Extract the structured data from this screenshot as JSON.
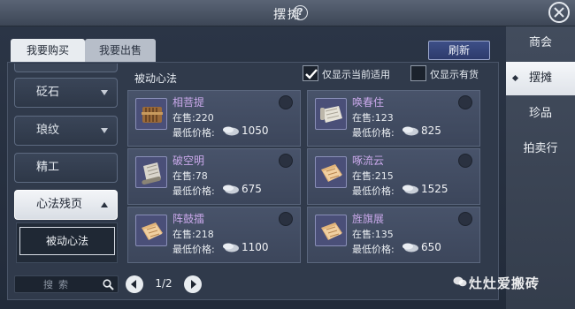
{
  "header": {
    "title": "摆摊",
    "help_symbol": "?"
  },
  "tabs": [
    {
      "label": "我要购买",
      "active": true
    },
    {
      "label": "我要出售",
      "active": false
    }
  ],
  "refresh_label": "刷新",
  "sidebar": {
    "items": [
      {
        "label": "砭石",
        "expandable": true
      },
      {
        "label": "琅纹",
        "expandable": true
      },
      {
        "label": "精工",
        "expandable": false
      },
      {
        "label": "心法残页",
        "expandable": true,
        "expanded": true
      }
    ],
    "sub_items": [
      {
        "label": "被动心法",
        "selected": true
      }
    ]
  },
  "search": {
    "placeholder": "搜索"
  },
  "pagination": {
    "text": "1/2"
  },
  "category_title": "被动心法",
  "filters": [
    {
      "label": "仅显示当前适用",
      "checked": true
    },
    {
      "label": "仅显示有货",
      "checked": false
    }
  ],
  "items": [
    {
      "name": "相菩提",
      "stock": "在售:220",
      "price_label": "最低价格:",
      "price": "1050",
      "icon": "bamboo-scroll-icon"
    },
    {
      "name": "唤春住",
      "stock": "在售:123",
      "price_label": "最低价格:",
      "price": "825",
      "icon": "paper-scroll-icon"
    },
    {
      "name": "破空明",
      "stock": "在售:78",
      "price_label": "最低价格:",
      "price": "675",
      "icon": "rolled-scroll-icon"
    },
    {
      "name": "啄流云",
      "stock": "在售:215",
      "price_label": "最低价格:",
      "price": "1525",
      "icon": "paper-pages-icon"
    },
    {
      "name": "阵鼓擂",
      "stock": "在售:218",
      "price_label": "最低价格:",
      "price": "1100",
      "icon": "paper-pages-icon"
    },
    {
      "name": "旌旗展",
      "stock": "在售:135",
      "price_label": "最低价格:",
      "price": "650",
      "icon": "paper-pages-icon"
    }
  ],
  "right_nav": [
    {
      "label": "商会",
      "active": false
    },
    {
      "label": "摆摊",
      "active": true
    },
    {
      "label": "珍品",
      "active": false
    },
    {
      "label": "拍卖行",
      "active": false
    }
  ],
  "watermark": "灶灶爱搬砖",
  "colors": {
    "item_name": "#c9a8ea",
    "refresh_bg": "#3d4f87",
    "icon_box_bg": "#4a4f78"
  }
}
